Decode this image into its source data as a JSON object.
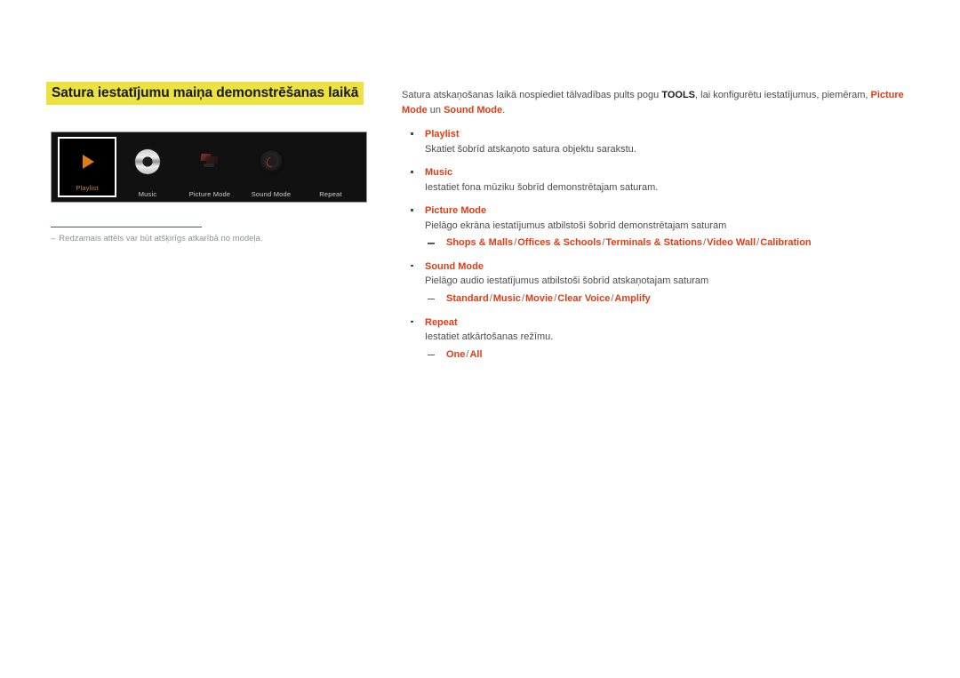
{
  "page": {
    "title": "Satura iestatījumu maiņa demonstrēšanas laikā",
    "accent_red": "#e03c13",
    "highlight_yellow": "#ece342"
  },
  "device_preview": {
    "selected_item": "Playlist",
    "items": [
      {
        "label": "Playlist",
        "icon": "play-triangle-icon",
        "selected": true
      },
      {
        "label": "Music",
        "icon": "cd-disc-icon",
        "selected": false
      },
      {
        "label": "Picture Mode",
        "icon": "picture-image-icon",
        "selected": false
      },
      {
        "label": "Sound Mode",
        "icon": "sound-knob-icon",
        "selected": false
      },
      {
        "label": "Repeat",
        "icon": "repeat-icon",
        "selected": false
      }
    ]
  },
  "footnote": {
    "dash": "–",
    "text": "Redzamais attēls var būt atšķirīgs atkarībā no modeļa."
  },
  "content": {
    "intro": {
      "part1": "Satura atskaņošanas laikā nospiediet tālvadības pults pogu ",
      "tools": "TOOLS",
      "part2": ", lai konfigurētu iestatījumus, piemēram, ",
      "picture_mode": "Picture Mode",
      "part3": " un ",
      "sound_mode": "Sound Mode",
      "part4": "."
    },
    "bullets": [
      {
        "title": "Playlist",
        "desc": "Skatiet šobrīd atskaņoto satura objektu sarakstu.",
        "options": []
      },
      {
        "title": "Music",
        "desc": "Iestatiet fona mūziku šobrīd demonstrētajam saturam.",
        "options": []
      },
      {
        "title": "Picture Mode",
        "desc": "Pielāgo ekrāna iestatījumus atbilstoši šobrīd demonstrētajam saturam",
        "options": [
          "Shops & Malls",
          "Offices & Schools",
          "Terminals & Stations",
          "Video Wall",
          "Calibration"
        ]
      },
      {
        "title": "Sound Mode",
        "desc": "Pielāgo audio iestatījumus atbilstoši šobrīd atskaņotajam saturam",
        "options": [
          "Standard",
          "Music",
          "Movie",
          "Clear Voice",
          "Amplify"
        ]
      },
      {
        "title": "Repeat",
        "desc": "Iestatiet atkārtošanas režīmu.",
        "options": [
          "One",
          "All"
        ]
      }
    ],
    "option_separator": "/"
  }
}
